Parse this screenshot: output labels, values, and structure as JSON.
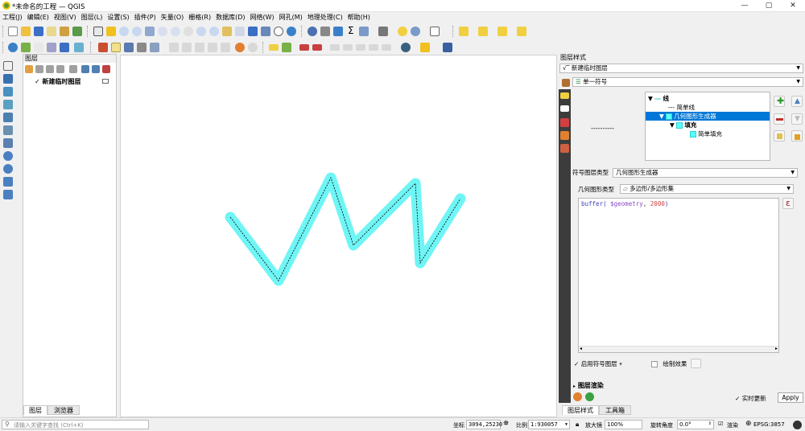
{
  "window": {
    "title": "*未命名的工程 — QGIS",
    "minimize": "—",
    "restore": "▢",
    "close": "✕"
  },
  "menu": [
    "工程(J)",
    "编辑(E)",
    "视图(V)",
    "图层(L)",
    "设置(S)",
    "插件(P)",
    "矢量(O)",
    "栅格(R)",
    "数据库(D)",
    "网络(W)",
    "网孔(M)",
    "地理处理(C)",
    "帮助(H)"
  ],
  "layers_panel": {
    "title": "图层",
    "layer_name": "新建临时图层",
    "layer_checked": "✓",
    "tabs": [
      "图层",
      "浏览器"
    ]
  },
  "style_panel": {
    "title": "图层样式",
    "layer_combo": "新建临时图层",
    "renderer_combo": "单一符号",
    "preview_line": "----------",
    "tree": [
      {
        "label": "线",
        "level": 0,
        "expander": "▼"
      },
      {
        "label": "简单线",
        "level": 1,
        "expander": ""
      },
      {
        "label": "几何图形生成器",
        "level": 1,
        "expander": "▼"
      },
      {
        "label": "填充",
        "level": 2,
        "expander": "▼"
      },
      {
        "label": "简单填充",
        "level": 3,
        "expander": ""
      }
    ],
    "symbol_layer_type_label": "符号图层类型",
    "symbol_layer_type": "几何图形生成器",
    "geometry_type_label": "几何图形类型",
    "geometry_type": "多边形/多边形集",
    "expression": {
      "fn": "buffer(",
      "field": " $geometry",
      "sep": ",",
      "num": " 2000",
      "close": ")"
    },
    "epsilon_button": "ε",
    "enable_symbol_layer": "启用符号图层",
    "draw_effects": "绘制效果",
    "layer_render": "图层渲染",
    "live_update": "实时更新",
    "apply": "Apply",
    "tabs": [
      "图层样式",
      "工具箱"
    ]
  },
  "status": {
    "search_placeholder": "请输入关键字查找 (Ctrl+K)",
    "coord_label": "坐标",
    "coord": "3094,25230",
    "scale_label": "比例",
    "scale": "1:930057",
    "magnifier_label": "放大镜",
    "magnifier": "100%",
    "rotation_label": "旋转角度",
    "rotation": "0.0°",
    "render_label": "渲染",
    "crs": "EPSG:3857"
  },
  "map": {
    "line_points": [
      [
        286,
        270
      ],
      [
        346,
        349
      ],
      [
        411,
        221
      ],
      [
        439,
        305
      ],
      [
        516,
        228
      ],
      [
        522,
        327
      ],
      [
        572,
        247
      ]
    ],
    "buffer_color": "#6ff5f5",
    "line_color": "#000000"
  },
  "colors": {
    "accent": "#0078d7",
    "selection": "#0078d7"
  }
}
